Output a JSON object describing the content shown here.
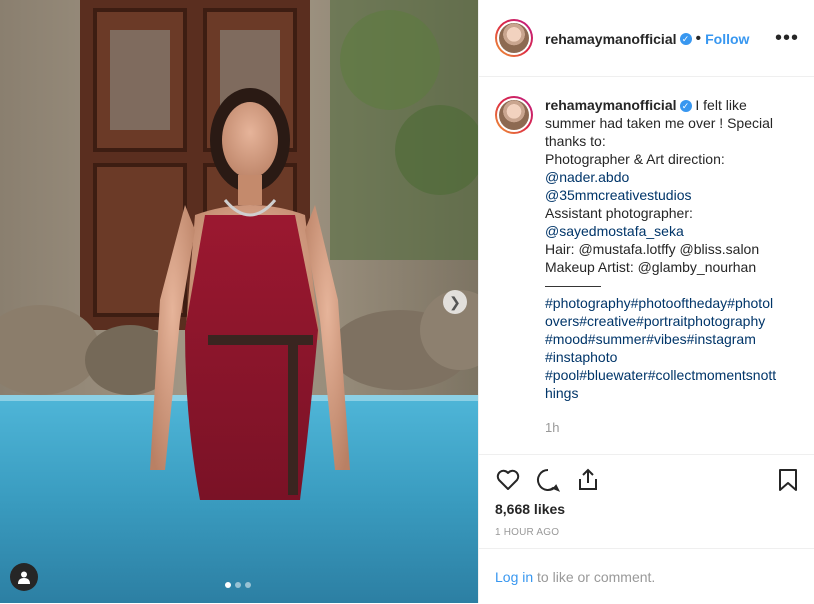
{
  "post": {
    "username": "rehamaymanofficial",
    "follow_label": "Follow",
    "more_label": "•••",
    "verified_mark": "✓",
    "caption_lines": [
      "I felt like",
      "summer had taken me over ! Special",
      "thanks to:",
      "Photographer & Art direction:",
      "@nader.abdo",
      "@35mmcreativestudios",
      "Assistant photographer:",
      "@sayedmostafa_seka",
      "Hair: @mustafa.lotffy @bliss.salon",
      "Makeup Artist: @glamby_nourhan",
      "————",
      "#photography#photooftheday#photol",
      "overs#creative#portraitphotography",
      "#mood#summer#vibes#instagram",
      "#instaphoto",
      "#pool#bluewater#collectmomentsnott",
      "hings"
    ],
    "caption_time": "1h",
    "likes": "8,668 likes",
    "posted_ago": "1 HOUR AGO",
    "login_link": "Log in",
    "login_text": " to like or comment."
  },
  "carousel": {
    "dot_count": 3,
    "active_index": 0
  },
  "colors": {
    "accent": "#3897f0",
    "mention": "#003569"
  }
}
